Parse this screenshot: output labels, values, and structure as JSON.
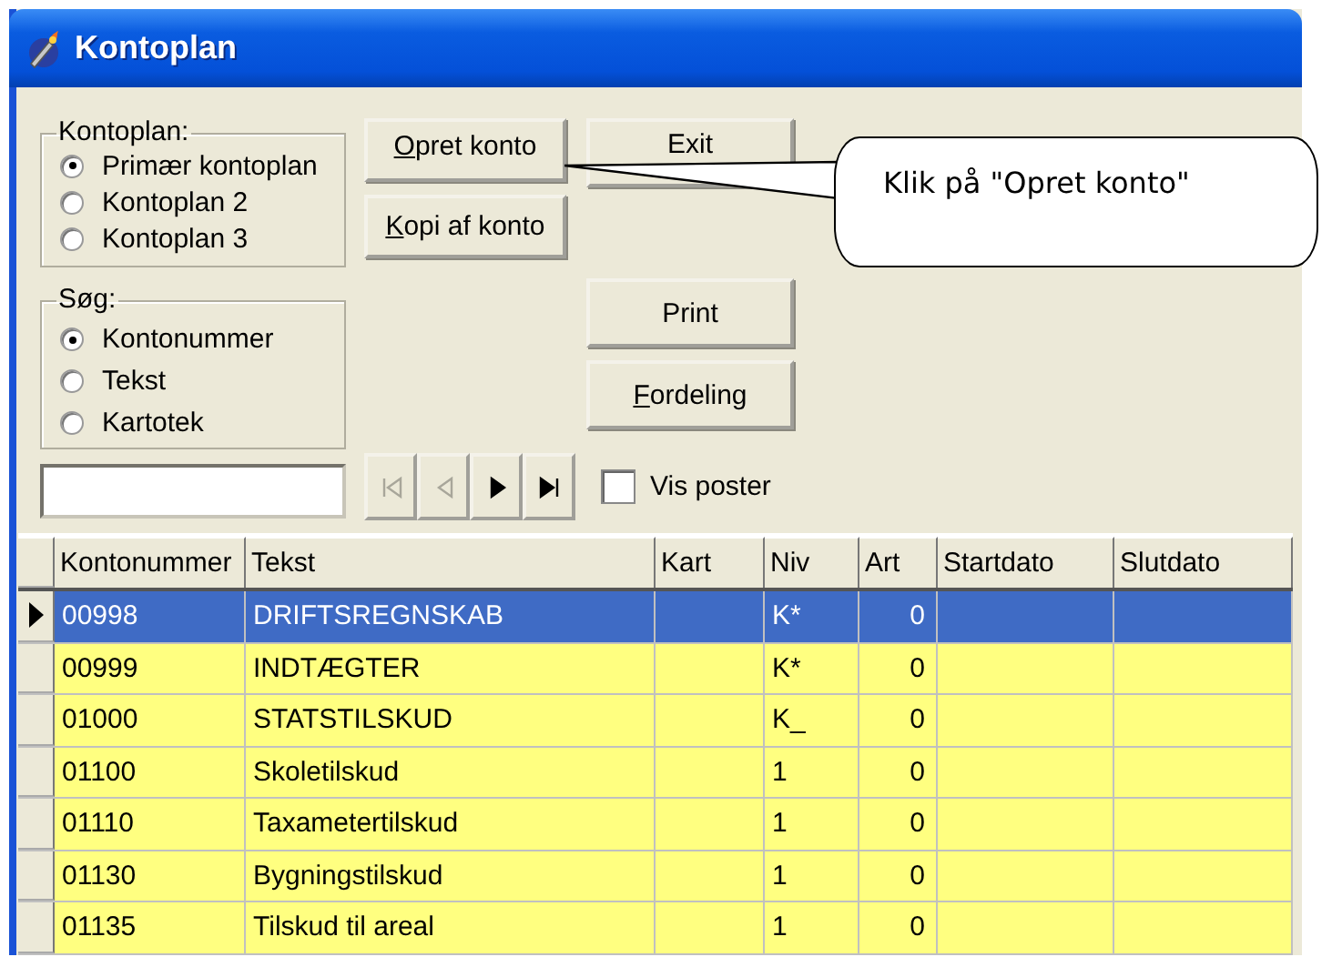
{
  "window": {
    "title": "Kontoplan"
  },
  "kontoplan_group": {
    "label": "Kontoplan:",
    "options": [
      {
        "label": "Primær kontoplan",
        "selected": true
      },
      {
        "label": "Kontoplan 2",
        "selected": false
      },
      {
        "label": "Kontoplan 3",
        "selected": false
      }
    ]
  },
  "search_group": {
    "label": "Søg:",
    "options": [
      {
        "label": "Kontonummer",
        "selected": true
      },
      {
        "label": "Tekst",
        "selected": false
      },
      {
        "label": "Kartotek",
        "selected": false
      }
    ]
  },
  "buttons_left": [
    {
      "mnemonic": "O",
      "rest": "pret konto"
    },
    {
      "mnemonic": "K",
      "rest": "opi af konto"
    }
  ],
  "exit_button": {
    "rest": "Exit"
  },
  "buttons_right": [
    {
      "rest": "Print"
    },
    {
      "mnemonic": "F",
      "rest": "ordeling"
    }
  ],
  "navigator": [
    {
      "kind": "first",
      "disabled": true
    },
    {
      "kind": "prev",
      "disabled": true
    },
    {
      "kind": "next",
      "disabled": false
    },
    {
      "kind": "last",
      "disabled": false
    }
  ],
  "vis_poster": {
    "label": "Vis poster",
    "checked": false
  },
  "table": {
    "columns": [
      "Kontonummer",
      "Tekst",
      "Kart",
      "Niv",
      "Art",
      "Startdato",
      "Slutdato"
    ],
    "rows": [
      {
        "selected": true,
        "cells": [
          "00998",
          "DRIFTSREGNSKAB",
          "",
          "K*",
          "0",
          "",
          ""
        ]
      },
      {
        "selected": false,
        "cells": [
          "00999",
          "INDTÆGTER",
          "",
          "K*",
          "0",
          "",
          ""
        ]
      },
      {
        "selected": false,
        "cells": [
          "01000",
          "STATSTILSKUD",
          "",
          "K_",
          "0",
          "",
          ""
        ]
      },
      {
        "selected": false,
        "cells": [
          "01100",
          "Skoletilskud",
          "",
          "1",
          "0",
          "",
          ""
        ]
      },
      {
        "selected": false,
        "cells": [
          "01110",
          "Taxametertilskud",
          "",
          "1",
          "0",
          "",
          ""
        ]
      },
      {
        "selected": false,
        "cells": [
          "01130",
          "Bygningstilskud",
          "",
          "1",
          "0",
          "",
          ""
        ]
      },
      {
        "selected": false,
        "cells": [
          "01135",
          "Tilskud til areal",
          "",
          "1",
          "0",
          "",
          ""
        ]
      }
    ]
  },
  "callout": {
    "text": "Klik på \"Opret konto\""
  }
}
